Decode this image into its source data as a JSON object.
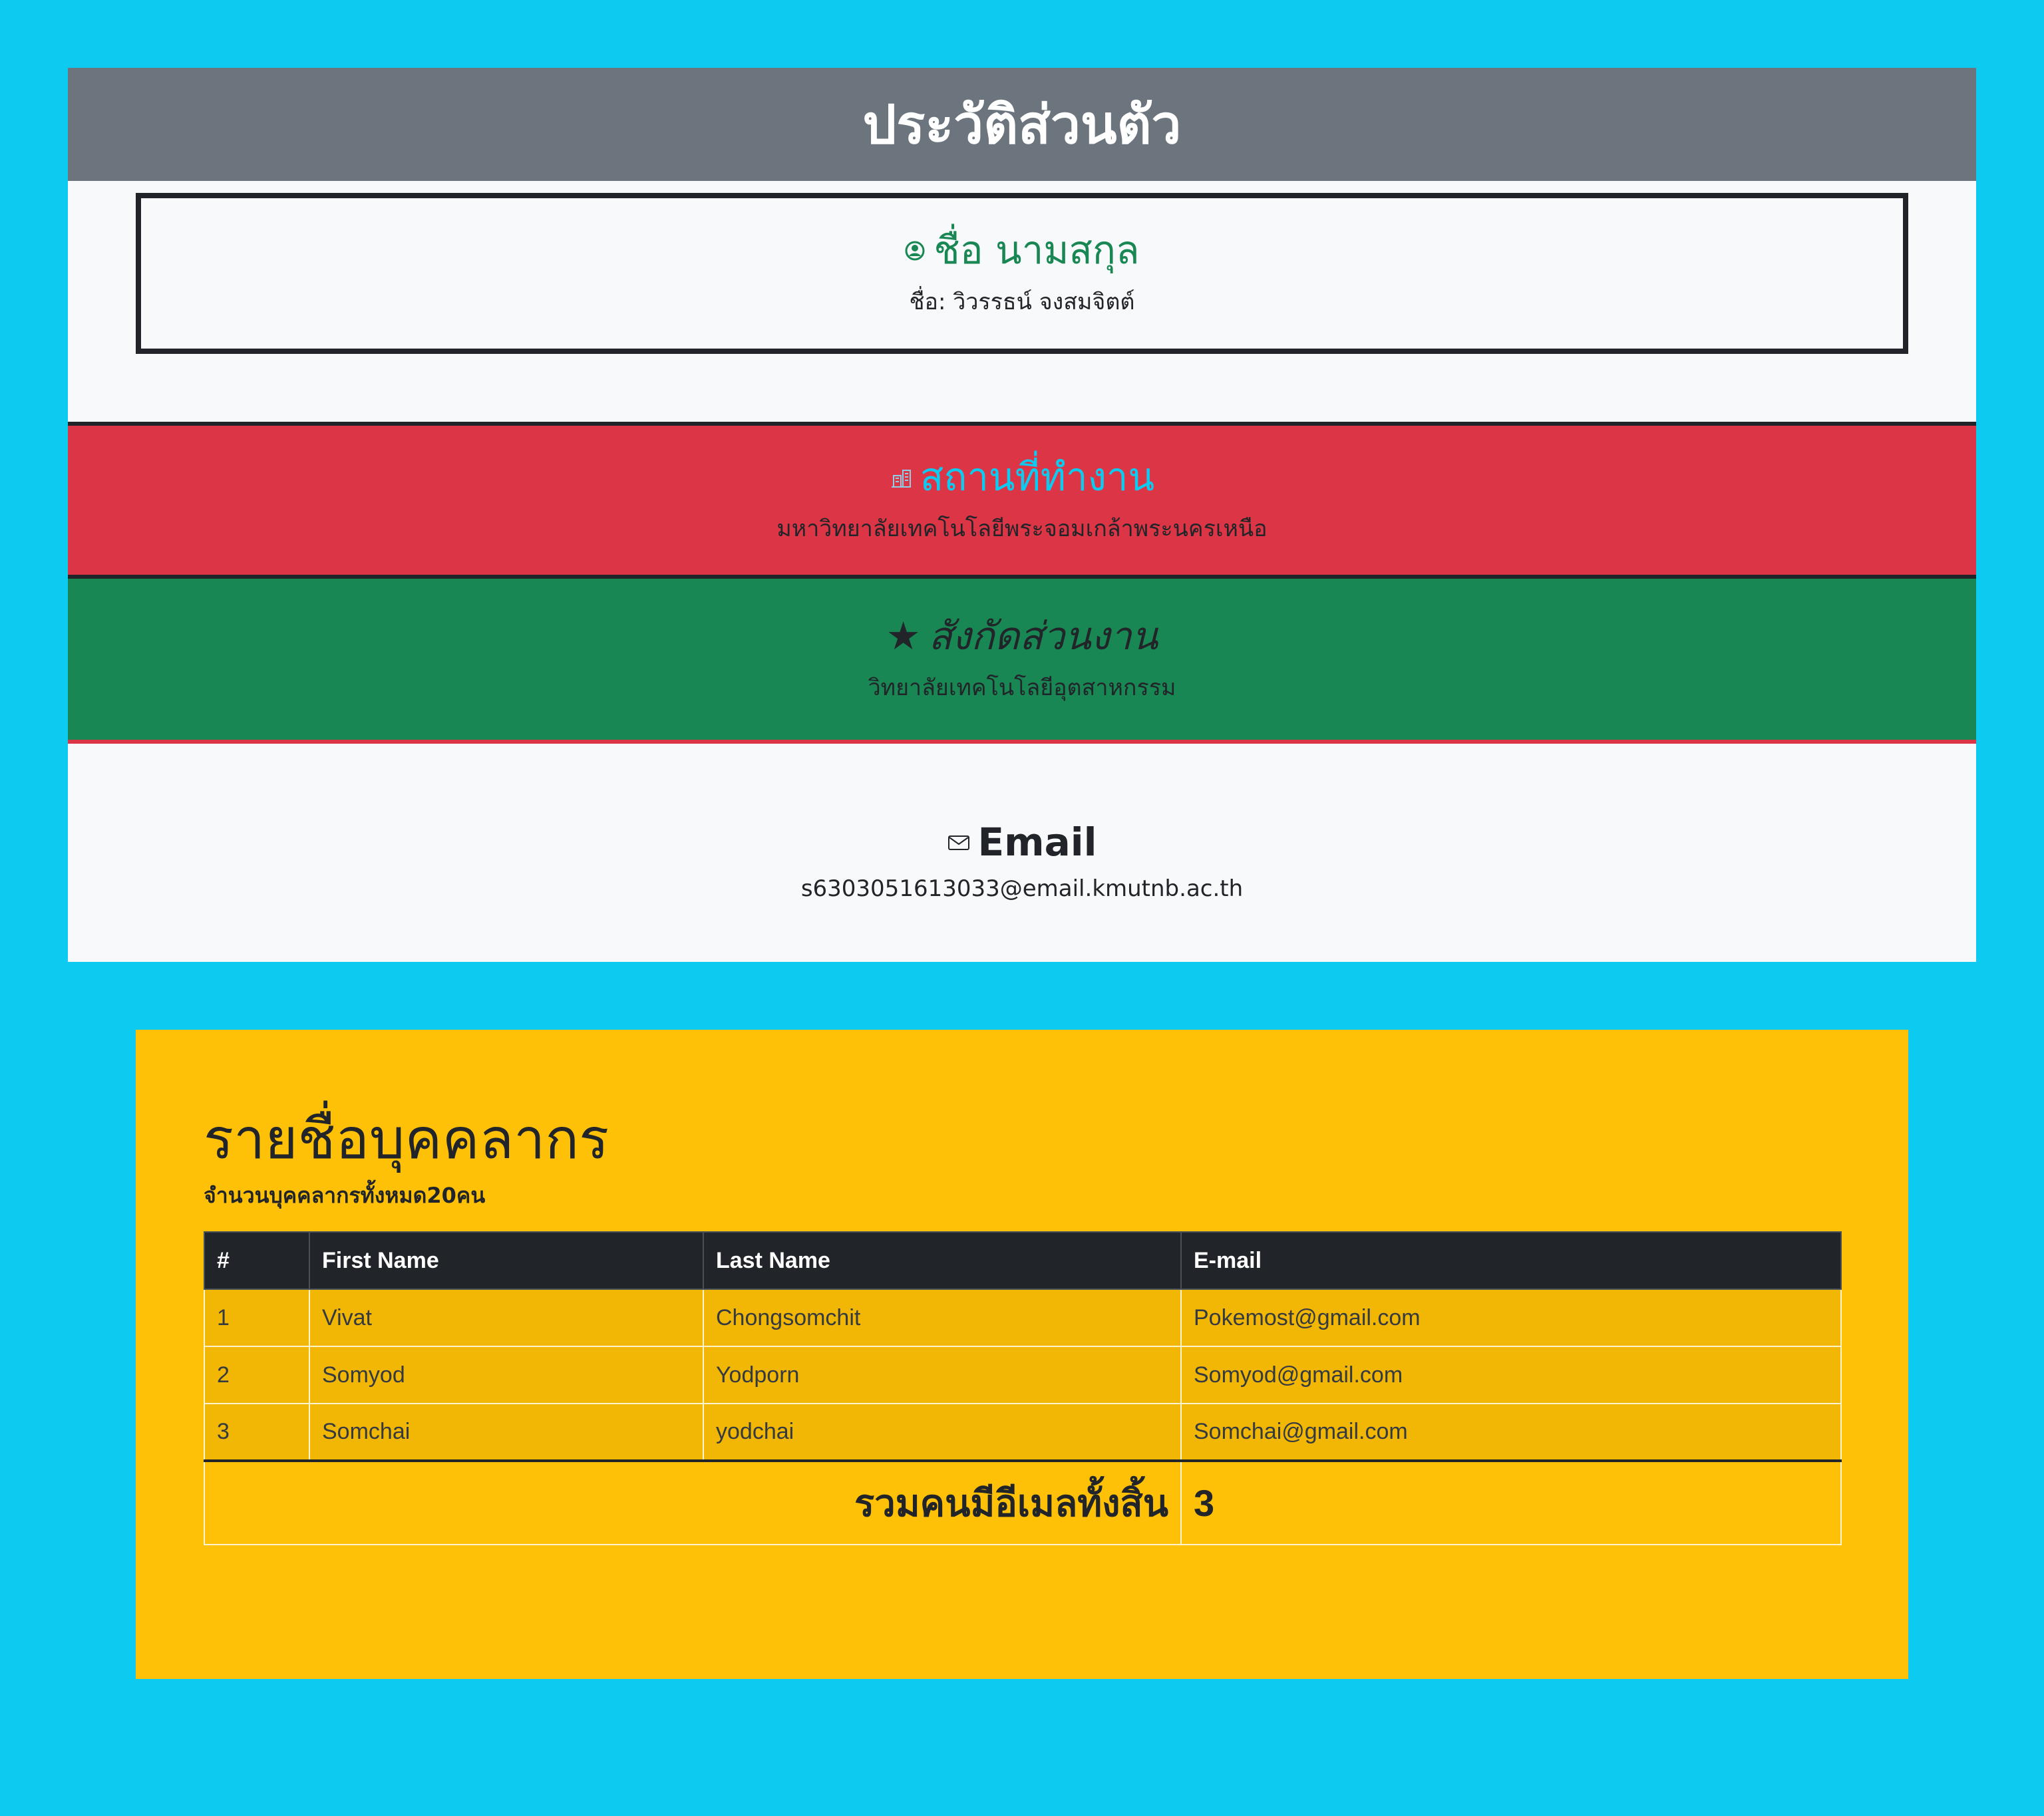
{
  "profile": {
    "header_title": "ประวัติส่วนตัว",
    "name_section": {
      "icon": "person-circle-icon",
      "title": "ชื่อ นามสกุล",
      "value": "ชื่อ: วิวรรธน์ จงสมจิตต์"
    },
    "workplace_section": {
      "icon": "building-icon",
      "title": "สถานที่ทำงาน",
      "value": "มหาวิทยาลัยเทคโนโลยีพระจอมเกล้าพระนครเหนือ"
    },
    "department_section": {
      "icon": "★",
      "title": "สังกัดส่วนงาน",
      "value": "วิทยาลัยเทคโนโลยีอุตสาหกรรม"
    },
    "email_section": {
      "icon": "envelope-icon",
      "title": "Email",
      "value": "s6303051613033@email.kmutnb.ac.th"
    }
  },
  "staff": {
    "title": "รายชื่อบุคคลากร",
    "count_text": "จำนวนบุคคลากรทั้งหมด20คน",
    "columns": [
      "#",
      "First Name",
      "Last Name",
      "E-mail"
    ],
    "rows": [
      [
        "1",
        "Vivat",
        "Chongsomchit",
        "Pokemost@gmail.com"
      ],
      [
        "2",
        "Somyod",
        "Yodporn",
        "Somyod@gmail.com"
      ],
      [
        "3",
        "Somchai",
        "yodchai",
        "Somchai@gmail.com"
      ]
    ],
    "total_label": "รวมคนมีอีเมลทั้งสิ้น",
    "total_value": "3"
  },
  "colors": {
    "page_background": "#0dcaf0",
    "header_gray": "#6c757d",
    "workplace_red": "#dc3545",
    "department_green": "#198754",
    "staff_panel_yellow": "#ffc107",
    "table_header_dark": "#212529"
  }
}
